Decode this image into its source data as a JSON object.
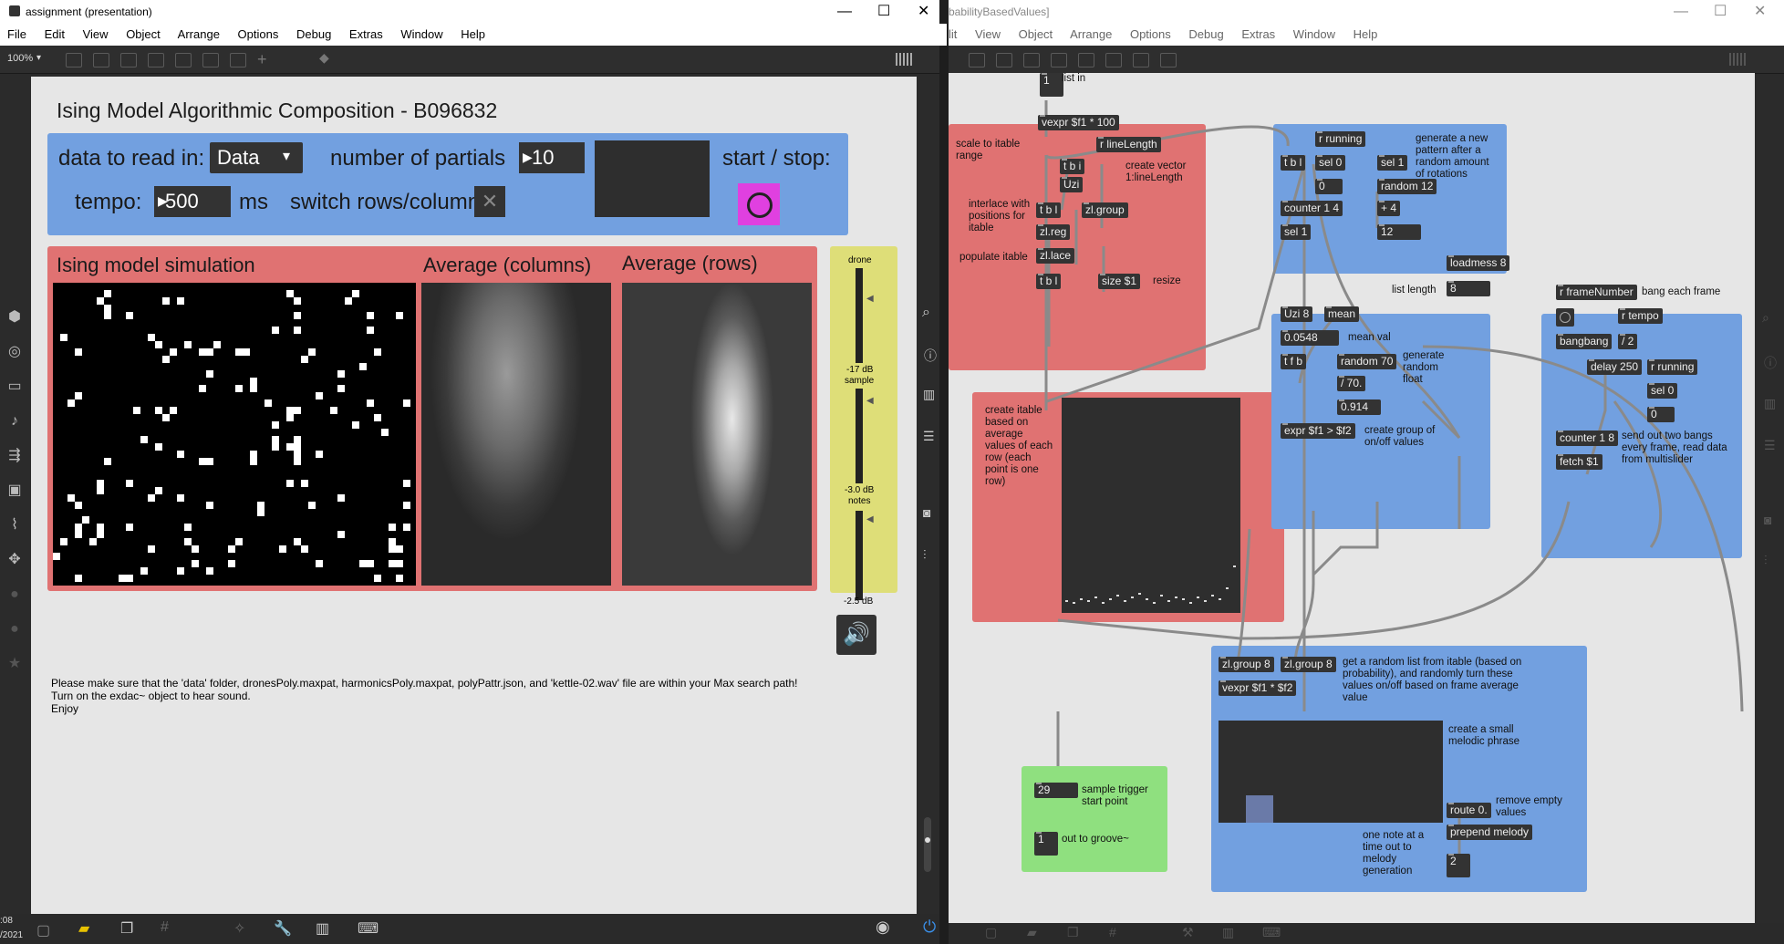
{
  "left": {
    "title": "assignment (presentation)",
    "menu": [
      "File",
      "Edit",
      "View",
      "Object",
      "Arrange",
      "Options",
      "Debug",
      "Extras",
      "Window",
      "Help"
    ],
    "zoom": "100%",
    "heading": "Ising Model Algorithmic Composition - B096832",
    "controls": {
      "data_label": "data to read in:",
      "data_value": "Data",
      "partials_label": "number of partials",
      "partials_value": "10",
      "startstop_label": "start / stop:",
      "tempo_label": "tempo:",
      "tempo_value": "500",
      "tempo_unit": "ms",
      "switch_label": "switch rows/columns:"
    },
    "sim_title": "Ising model simulation",
    "avg_cols_title": "Average (columns)",
    "avg_rows_title": "Average (rows)",
    "mixer": {
      "drone": "drone",
      "drone_db": "-17 dB",
      "sample": "sample",
      "sample_db": "-3.0 dB",
      "notes": "notes",
      "notes_db": "-2.5 dB"
    },
    "notice": [
      "Please make sure that the 'data' folder, dronesPoly.maxpat, harmonicsPoly.maxpat, polyPattr.json, and 'kettle-02.wav' file are within your Max search path!",
      "Turn on the exdac~ object to hear sound.",
      "Enjoy"
    ],
    "clock_a": ":08",
    "clock_b": "/2021"
  },
  "right": {
    "title": "babilityBasedValues]",
    "menu": [
      "lit",
      "View",
      "Object",
      "Arrange",
      "Options",
      "Debug",
      "Extras",
      "Window",
      "Help"
    ],
    "list_in_val": "1",
    "list_in_label": "list in",
    "objects": {
      "vexpr_scale": "vexpr $f1 * 100",
      "r_lineLength": "r lineLength",
      "tbi": "t b i",
      "uzi": "Uzi",
      "tbl1": "t b l",
      "zlgroup": "zl.group",
      "zlreg": "zl.reg",
      "zllace": "zl.lace",
      "tbl2": "t b l",
      "size": "size $1",
      "r_running1": "r running",
      "tbl3": "t b l",
      "sel0a": "sel 0",
      "sel1a": "sel 1",
      "zero1": "0",
      "random12": "random 12",
      "counter14": "counter 1 4",
      "plus4": "+ 4",
      "sel1b": "sel 1",
      "twelve": "12",
      "loadmess": "loadmess 8",
      "eight": "8",
      "uzi8": "Uzi 8",
      "mean": "mean",
      "meanval": "0.0548",
      "tfb": "t f b",
      "random70": "random 70",
      "div70": "/ 70.",
      "val914": "0.914",
      "expr": "expr $f1 > $f2",
      "r_frameNumber": "r frameNumber",
      "r_tempo": "r tempo",
      "bangbang": "bangbang",
      "div2": "/ 2",
      "delay250": "delay 250",
      "r_running2": "r running",
      "sel0b": "sel 0",
      "zero2": "0",
      "counter18": "counter 1 8",
      "fetch": "fetch $1",
      "zlgroup8a": "zl.group 8",
      "zlgroup8b": "zl.group 8",
      "vexpr_mul": "vexpr $f1 * $f2",
      "route0": "route 0.",
      "prepend": "prepend melody",
      "out2": "2",
      "trig29": "29",
      "out1": "1"
    },
    "comments": {
      "scale": "scale to itable range",
      "create_vector": "create vector 1:lineLength",
      "interlace": "interlace with positions for itable",
      "populate": "populate itable",
      "resize": "resize",
      "create_itable": "create itable based on average values of each row (each point is one row)",
      "generate_pattern": "generate a new pattern after a random amount of rotations",
      "list_length": "list length",
      "mean_val": "mean val",
      "gen_random": "generate random float",
      "create_group": "create group of on/off values",
      "bang_each": "bang each frame",
      "send_two": "send out two bangs every frame, read data from multislider",
      "get_random": "get a random list from itable (based on probability), and randomly turn these values on/off based on frame average value",
      "small_phrase": "create a small melodic phrase",
      "remove_empty": "remove empty values",
      "one_note": "one note at a time out to melody generation",
      "sample_trigger": "sample trigger start point",
      "out_groove": "out to groove~"
    }
  },
  "colors": {
    "blue": "#72a0e0",
    "red": "#e07272",
    "yellow": "#dede78",
    "green": "#8fe07f",
    "toggle": "#e040e0"
  },
  "icons": [
    "minimize-icon",
    "maximize-icon",
    "close-icon",
    "search-icon",
    "info-icon",
    "speaker-icon",
    "wrench-icon"
  ]
}
